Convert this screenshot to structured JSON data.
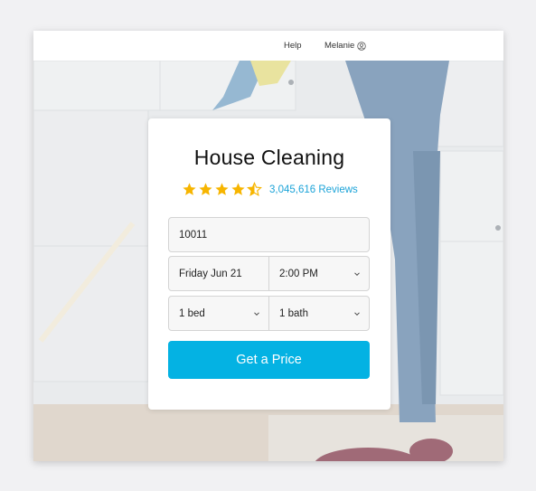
{
  "header": {
    "help_label": "Help",
    "user_name": "Melanie"
  },
  "card": {
    "title": "House Cleaning",
    "rating": 4.5,
    "reviews_label": "3,045,616 Reviews",
    "zip_value": "10011",
    "date_value": "Friday Jun 21",
    "time_value": "2:00 PM",
    "bed_value": "1 bed",
    "bath_value": "1 bath",
    "cta_label": "Get a Price"
  },
  "colors": {
    "accent": "#04b2e3",
    "star": "#f7b500",
    "link": "#1ba3d8"
  },
  "icons": {
    "user": "user-circle-icon",
    "chevron": "chevron-down-icon",
    "star": "star-icon"
  }
}
